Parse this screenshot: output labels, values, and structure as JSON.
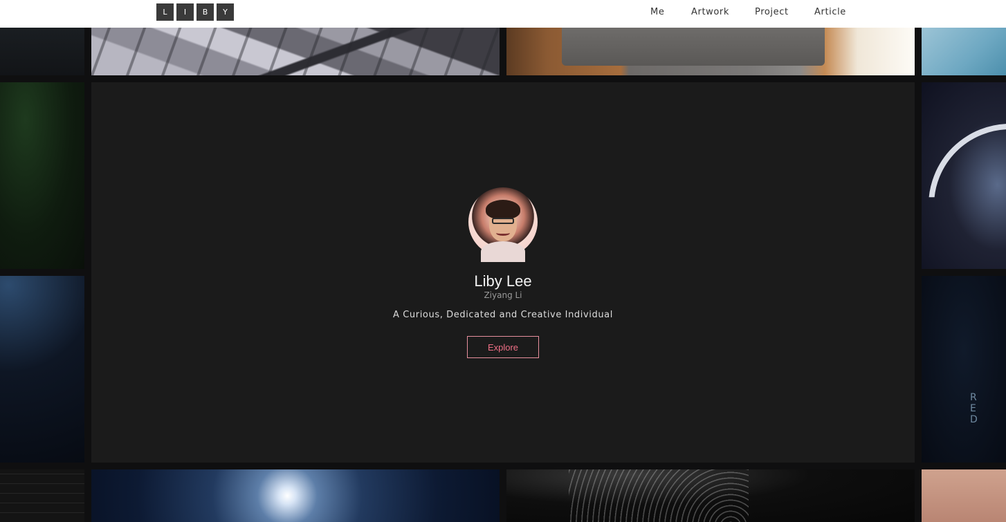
{
  "header": {
    "logo_letters": [
      "L",
      "I",
      "B",
      "Y"
    ],
    "nav": [
      {
        "label": "Me"
      },
      {
        "label": "Artwork"
      },
      {
        "label": "Project"
      },
      {
        "label": "Article"
      }
    ]
  },
  "hero": {
    "name": "Liby Lee",
    "subname": "Ziyang Li",
    "tagline": "A Curious, Dedicated and Creative Individual",
    "explore_label": "Explore"
  },
  "tiles": {
    "side_right_overlay_text": "R E D"
  },
  "colors": {
    "header_bg": "#ffffff",
    "panel_bg": "#1b1b1b",
    "accent": "#ef6f86"
  }
}
